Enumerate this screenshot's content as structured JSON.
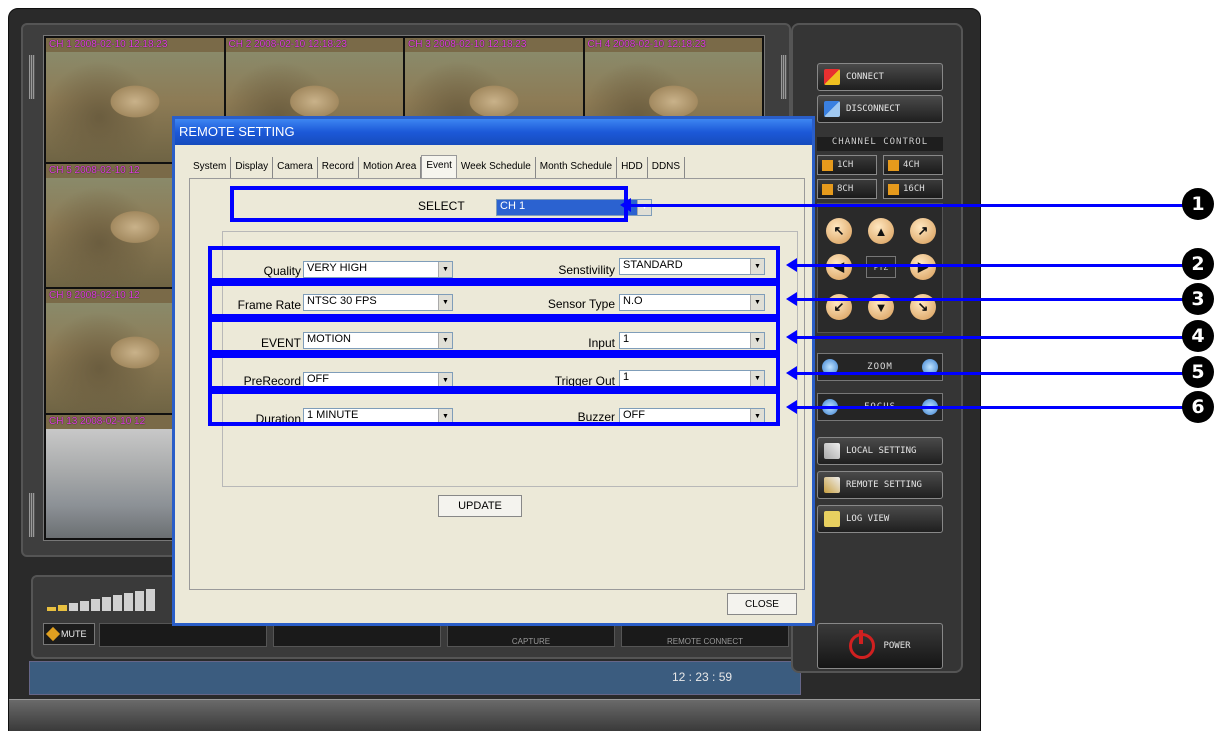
{
  "cameras": [
    {
      "label": "CH 1 2008-02-10 12:18:23"
    },
    {
      "label": "CH 2 2008-02-10 12:18:23"
    },
    {
      "label": "CH 3 2008-02-10 12:18:23"
    },
    {
      "label": "CH 4 2008-02-10 12:18:23"
    },
    {
      "label": "CH 5 2008-02-10 12"
    },
    {
      "label": "CH 9 2008-02-10 12"
    },
    {
      "label": "CH 13 2008-02-10 12"
    }
  ],
  "right_panel": {
    "connect": "CONNECT",
    "disconnect": "DISCONNECT",
    "channel_control": "CHANNEL CONTROL",
    "ch1": "1CH",
    "ch4": "4CH",
    "ch8": "8CH",
    "ch16": "16CH",
    "ptz": "PTZ",
    "zoom": "ZOOM",
    "focus": "FOCUS",
    "local_setting": "LOCAL SETTING",
    "remote_setting": "REMOTE SETTING",
    "log_view": "LOG VIEW",
    "power": "POWER"
  },
  "bottom": {
    "mute": "MUTE",
    "slot_capture": "CAPTURE",
    "slot_remote": "REMOTE CONNECT",
    "clock": "12 : 23 : 59"
  },
  "dialog": {
    "title": "REMOTE SETTING",
    "tabs": [
      "System",
      "Display",
      "Camera",
      "Record",
      "Motion Area",
      "Event",
      "Week Schedule",
      "Month Schedule",
      "HDD",
      "DDNS"
    ],
    "active_tab": "Event",
    "select_label": "SELECT",
    "select_value": "CH 1",
    "fields": {
      "quality_label": "Quality",
      "quality_value": "VERY HIGH",
      "sensitivity_label": "Senstivility",
      "sensitivity_value": "STANDARD",
      "frame_rate_label": "Frame Rate",
      "frame_rate_value": "NTSC 30 FPS",
      "sensor_type_label": "Sensor Type",
      "sensor_type_value": "N.O",
      "event_label": "EVENT",
      "event_value": "MOTION",
      "input_label": "Input",
      "input_value": "1",
      "prerecord_label": "PreRecord",
      "prerecord_value": "OFF",
      "trigger_out_label": "Trigger Out",
      "trigger_out_value": "1",
      "duration_label": "Duration",
      "duration_value": "1 MINUTE",
      "buzzer_label": "Buzzer",
      "buzzer_value": "OFF"
    },
    "update": "UPDATE",
    "close": "CLOSE"
  },
  "callouts": [
    "1",
    "2",
    "3",
    "4",
    "5",
    "6"
  ],
  "colors": {
    "highlight": "#0000ff",
    "title_bar": "#1c59d8",
    "camera_label": "#e040e0"
  }
}
